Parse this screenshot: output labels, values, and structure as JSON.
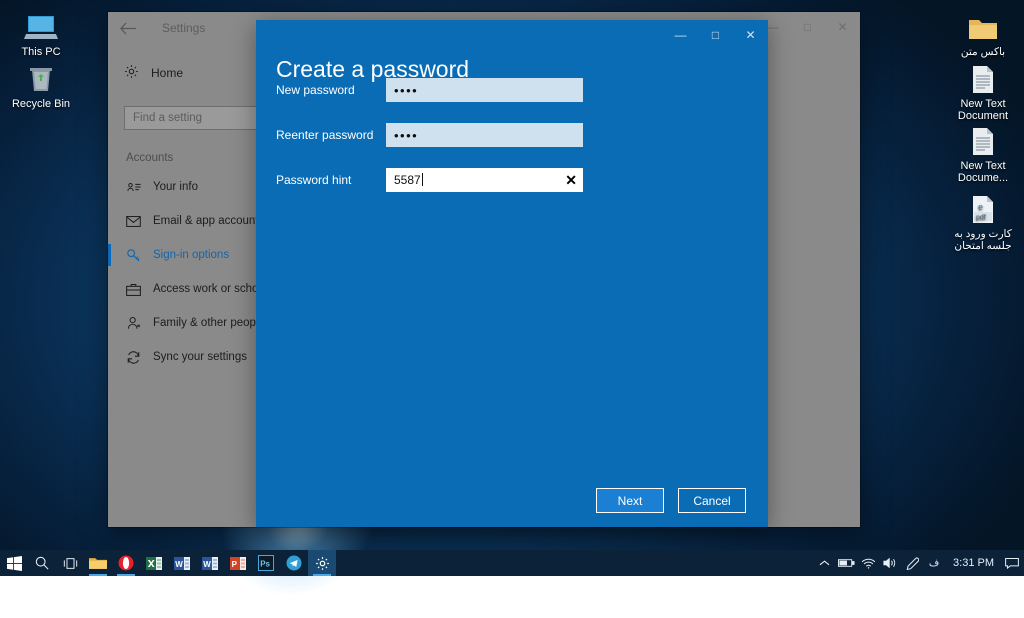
{
  "desktop": {
    "icons_left": [
      {
        "label": "This PC",
        "icon": "monitor-icon"
      },
      {
        "label": "Recycle Bin",
        "icon": "recycle-bin-icon"
      }
    ],
    "icons_right": [
      {
        "label": "باكس متن",
        "icon": "folder-icon",
        "rtl": true
      },
      {
        "label": "New Text Document",
        "icon": "text-file-icon",
        "rtl": false
      },
      {
        "label": "New Text Docume...",
        "icon": "text-file-icon",
        "rtl": false
      },
      {
        "label": "کارت ورود به جلسه امتحان",
        "icon": "pdf-file-icon",
        "rtl": true
      }
    ]
  },
  "settings_window": {
    "title": "Settings",
    "back_icon": "back-arrow-icon",
    "controls": {
      "minimize": "—",
      "maximize": "□",
      "close": "✕"
    },
    "nav": {
      "home_label": "Home",
      "home_icon": "gear-icon",
      "search_placeholder": "Find a setting",
      "group_label": "Accounts",
      "items": [
        {
          "label": "Your info",
          "icon": "contact-card-icon",
          "active": false
        },
        {
          "label": "Email & app accounts",
          "icon": "envelope-icon",
          "active": false
        },
        {
          "label": "Sign-in options",
          "icon": "key-icon",
          "active": true
        },
        {
          "label": "Access work or school",
          "icon": "briefcase-icon",
          "active": false
        },
        {
          "label": "Family & other people",
          "icon": "person-icon",
          "active": false
        },
        {
          "label": "Sync your settings",
          "icon": "sync-icon",
          "active": false
        }
      ]
    }
  },
  "dialog": {
    "title": "Create a password",
    "controls": {
      "minimize": "—",
      "maximize": "□",
      "close": "✕"
    },
    "fields": [
      {
        "label": "New password",
        "value": "••••",
        "type": "password"
      },
      {
        "label": "Reenter password",
        "value": "••••",
        "type": "password"
      },
      {
        "label": "Password hint",
        "value": "5587",
        "type": "text",
        "clear_icon": "✕"
      }
    ],
    "buttons": [
      {
        "label": "Next",
        "primary": true
      },
      {
        "label": "Cancel",
        "primary": false
      }
    ]
  },
  "taskbar": {
    "items": [
      {
        "name": "start-button",
        "icon": "windows-logo-icon"
      },
      {
        "name": "search-button",
        "icon": "search-icon"
      },
      {
        "name": "task-view-button",
        "icon": "task-view-icon"
      },
      {
        "name": "file-explorer-button",
        "icon": "folder-icon"
      },
      {
        "name": "opera-button",
        "icon": "opera-icon"
      },
      {
        "name": "excel-button",
        "icon": "excel-icon"
      },
      {
        "name": "word-button",
        "icon": "word-icon"
      },
      {
        "name": "word2-button",
        "icon": "word-icon"
      },
      {
        "name": "powerpoint-button",
        "icon": "powerpoint-icon"
      },
      {
        "name": "photoshop-button",
        "icon": "photoshop-icon"
      },
      {
        "name": "telegram-button",
        "icon": "telegram-icon"
      },
      {
        "name": "settings-taskbar-button",
        "icon": "gear-icon"
      }
    ],
    "tray": {
      "chevron": "︿",
      "icons": [
        "battery-icon",
        "wifi-icon",
        "volume-icon",
        "pen-icon",
        "language-icon"
      ],
      "language": "ف",
      "clock": "3:31 PM",
      "notification_icon": "notification-icon"
    }
  },
  "colors": {
    "dialog_blue": "#0a6cb5",
    "primary_button": "#1b7fd4",
    "settings_gray": "#8a8a8a",
    "accent": "#0a69b8",
    "taskbar": "#0b2239"
  }
}
